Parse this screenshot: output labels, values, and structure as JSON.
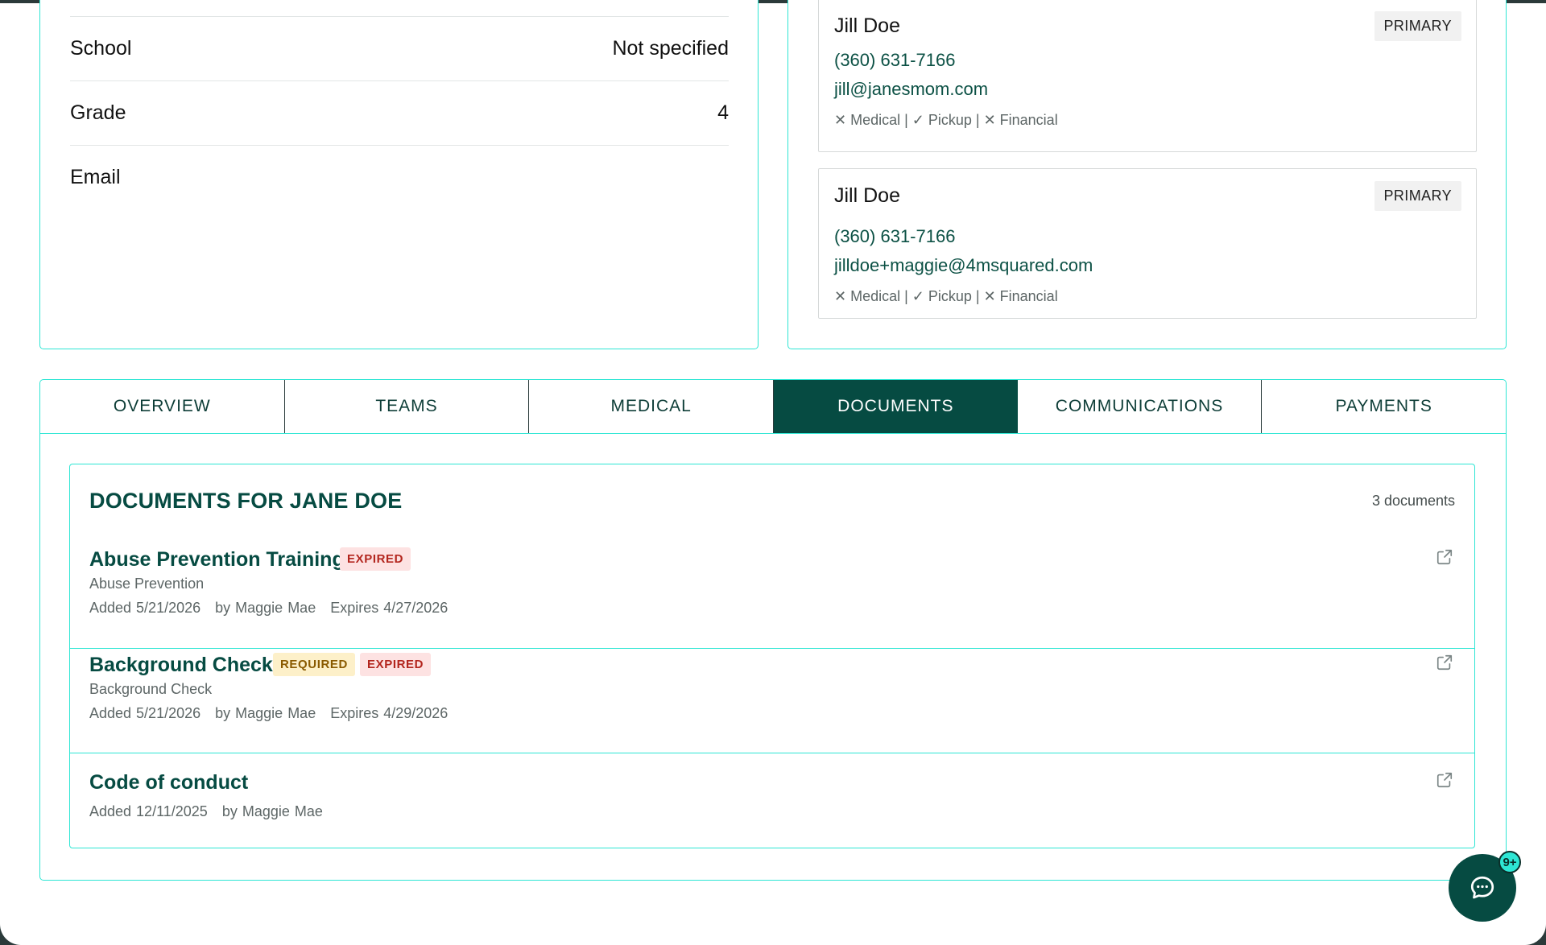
{
  "student_info": {
    "rows": [
      {
        "label": "School",
        "value": "Not specified"
      },
      {
        "label": "Grade",
        "value": "4"
      },
      {
        "label": "Email",
        "value": ""
      }
    ]
  },
  "contacts": [
    {
      "name": "Jill Doe",
      "badge": "PRIMARY",
      "phone": "(360) 631-7166",
      "email": "jill@janesmom.com",
      "permissions": "✕ Medical | ✓ Pickup | ✕ Financial"
    },
    {
      "name": "Jill Doe",
      "badge": "PRIMARY",
      "phone": "(360) 631-7166",
      "email": "jilldoe+maggie@4msquared.com",
      "permissions": "✕ Medical | ✓ Pickup | ✕ Financial"
    }
  ],
  "tabs": [
    {
      "label": "OVERVIEW",
      "active": false
    },
    {
      "label": "TEAMS",
      "active": false
    },
    {
      "label": "MEDICAL",
      "active": false
    },
    {
      "label": "DOCUMENTS",
      "active": true
    },
    {
      "label": "COMMUNICATIONS",
      "active": false
    },
    {
      "label": "PAYMENTS",
      "active": false
    }
  ],
  "documents": {
    "title": "DOCUMENTS FOR JANE DOE",
    "count": "3 documents",
    "items": [
      {
        "title": "Abuse Prevention Training",
        "badges": [
          "EXPIRED"
        ],
        "category": "Abuse Prevention",
        "added": "Added 5/21/2026",
        "by": "by Maggie Mae",
        "expires": "Expires 4/27/2026"
      },
      {
        "title": "Background Check",
        "badges": [
          "REQUIRED",
          "EXPIRED"
        ],
        "category": "Background Check",
        "added": "Added 5/21/2026",
        "by": "by Maggie Mae",
        "expires": "Expires 4/29/2026"
      },
      {
        "title": "Code of conduct",
        "badges": [],
        "category": "",
        "added": "Added 12/11/2025",
        "by": "by Maggie Mae",
        "expires": ""
      }
    ]
  },
  "chat": {
    "badge": "9+",
    "icon": "chat-bubble-icon"
  },
  "colors": {
    "accent": "#2ee6d4",
    "primary": "#064b42",
    "expired_bg": "#fde2e2",
    "required_bg": "#fdf0c9"
  }
}
